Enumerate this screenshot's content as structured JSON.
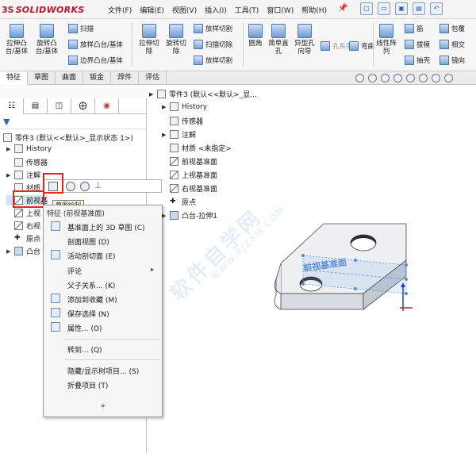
{
  "app": {
    "logo_prefix": "3S",
    "logo_name": "SOLIDWORKS",
    "menus": [
      "文件(F)",
      "编辑(E)",
      "视图(V)",
      "插入(I)",
      "工具(T)",
      "窗口(W)",
      "帮助(H)"
    ],
    "pin_icon": "pin-icon",
    "quick_access": [
      "new-icon",
      "open-icon",
      "save-icon",
      "print-icon",
      "undo-icon"
    ]
  },
  "ribbon": {
    "big": [
      {
        "label": "拉伸凸\n台/基体",
        "icon": "extrude-boss-icon"
      },
      {
        "label": "旋转凸\n台/基体",
        "icon": "revolve-boss-icon"
      },
      {
        "label": "拉伸切\n除",
        "icon": "extrude-cut-icon"
      },
      {
        "label": "旋转切\n除",
        "icon": "revolve-cut-icon"
      },
      {
        "label": "圆角",
        "icon": "fillet-icon"
      },
      {
        "label": "简单直\n孔",
        "icon": "simple-hole-icon"
      },
      {
        "label": "异型孔\n向导",
        "icon": "hole-wizard-icon"
      },
      {
        "label": "线性阵\n列",
        "icon": "linear-pattern-icon"
      }
    ],
    "small": [
      {
        "label": "扫描",
        "icon": "sweep-icon"
      },
      {
        "label": "放样凸台/基体",
        "icon": "loft-boss-icon"
      },
      {
        "label": "边界凸台/基体",
        "icon": "boundary-boss-icon"
      },
      {
        "label": "放样切割",
        "icon": "loft-cut-icon"
      },
      {
        "label": "扫描切除",
        "icon": "sweep-cut-icon"
      },
      {
        "label": "放样切割",
        "icon": "loft-cut-icon"
      },
      {
        "label": "孔系列",
        "icon": "hole-series-icon"
      },
      {
        "label": "弯曲",
        "icon": "flex-icon"
      },
      {
        "label": "筋",
        "icon": "rib-icon"
      },
      {
        "label": "拔模",
        "icon": "draft-icon"
      },
      {
        "label": "抽壳",
        "icon": "shell-icon"
      },
      {
        "label": "包覆",
        "icon": "wrap-icon"
      },
      {
        "label": "相交",
        "icon": "intersect-icon"
      },
      {
        "label": "镜向",
        "icon": "mirror-icon"
      }
    ]
  },
  "tabs": [
    "特征",
    "草图",
    "曲面",
    "钣金",
    "焊件",
    "评估"
  ],
  "left_tree": {
    "root": "零件3 (默认<<默认>_显示状态 1>)",
    "items": [
      {
        "label": "History",
        "icon": "history-icon"
      },
      {
        "label": "传感器",
        "icon": "sensor-icon"
      },
      {
        "label": "注解",
        "icon": "annotation-icon"
      },
      {
        "label": "材质",
        "icon": "material-icon"
      },
      {
        "label": "前视基",
        "icon": "plane-icon"
      },
      {
        "label": "上视",
        "icon": "plane-icon"
      },
      {
        "label": "右视",
        "icon": "plane-icon"
      },
      {
        "label": "原点",
        "icon": "origin-icon"
      },
      {
        "label": "凸台",
        "icon": "boss-extrude-icon"
      }
    ]
  },
  "tooltip": "草图绘制",
  "context_menu": {
    "header": "特征 (前视基准面)",
    "items": [
      {
        "label": "基准面上的 3D 草图 (C)",
        "icon": "3d-sketch-icon"
      },
      {
        "label": "剖面视图 (D)",
        "icon": ""
      },
      {
        "label": "活动剖切面 (E)",
        "icon": "section-plane-icon"
      },
      {
        "label": "评论",
        "icon": "",
        "submenu": true
      },
      {
        "label": "父子关系... (K)",
        "icon": ""
      },
      {
        "label": "添加到收藏 (M)",
        "icon": "favorite-icon"
      },
      {
        "label": "保存选择 (N)",
        "icon": "save-selection-icon"
      },
      {
        "label": "属性... (O)",
        "icon": "properties-icon"
      },
      {
        "label": "转到... (Q)",
        "icon": ""
      },
      {
        "label": "隐藏/显示树项目... (S)",
        "icon": ""
      },
      {
        "label": "折叠项目 (T)",
        "icon": ""
      }
    ],
    "more": "»"
  },
  "right_tree": {
    "root": "零件3 (默认<<默认>_显...",
    "items": [
      {
        "label": "History"
      },
      {
        "label": "传感器"
      },
      {
        "label": "注解"
      },
      {
        "label": "材质 <未指定>"
      },
      {
        "label": "前视基准面"
      },
      {
        "label": "上视基准面"
      },
      {
        "label": "右视基准面"
      },
      {
        "label": "原点"
      },
      {
        "label": "凸台-拉伸1"
      }
    ]
  },
  "viewport": {
    "plane_label": "前视基准面"
  },
  "watermark": {
    "main": "软件自学网",
    "sub": "WWW.RJZXW.COM"
  }
}
